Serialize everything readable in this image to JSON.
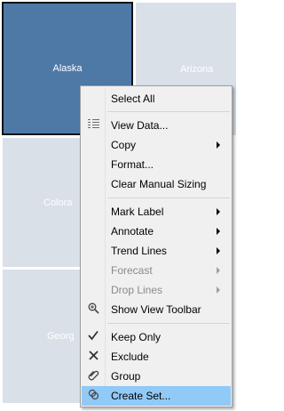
{
  "tiles": {
    "alaska": "Alaska",
    "arizona": "Arizona",
    "colorado": "Colora",
    "georgia": "Georg"
  },
  "colors": {
    "selected_tile": "#4e79a7",
    "tile": "#d9e0e8",
    "menu_bg": "#f0f0f0",
    "hover": "#91c9f7"
  },
  "menu": {
    "select_all": "Select All",
    "view_data": "View Data...",
    "copy": "Copy",
    "format": "Format...",
    "clear_manual_sizing": "Clear Manual Sizing",
    "mark_label": "Mark Label",
    "annotate": "Annotate",
    "trend_lines": "Trend Lines",
    "forecast": "Forecast",
    "drop_lines": "Drop Lines",
    "show_view_toolbar": "Show View Toolbar",
    "keep_only": "Keep Only",
    "exclude": "Exclude",
    "group": "Group",
    "create_set": "Create Set..."
  },
  "icons": {
    "view_data": "table-icon",
    "show_view_toolbar": "zoom-icon",
    "keep_only": "checkmark-icon",
    "exclude": "x-icon",
    "group": "paperclip-icon",
    "create_set": "set-icon"
  }
}
